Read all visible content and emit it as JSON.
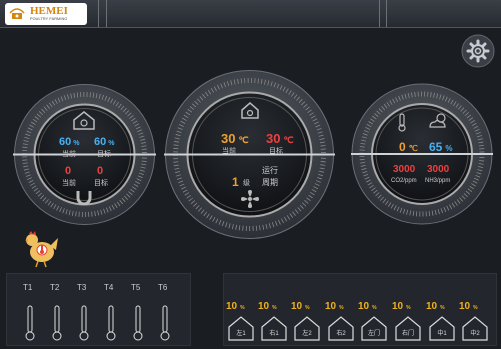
{
  "brand": {
    "name": "HEMEI",
    "tagline": "POULTRY FARMING"
  },
  "colors": {
    "blue": "#4ab0f0",
    "red": "#ee4040",
    "orange": "#f0a030",
    "yellow": "#f0b020"
  },
  "left_dial": {
    "humidity_current": "60",
    "humidity_target": "60",
    "humidity_unit": "%",
    "pressure_current": "0",
    "pressure_target": "0",
    "current_label": "当前",
    "target_label": "目标",
    "top_icon": "house-icon",
    "bottom_icon": "magnet-icon"
  },
  "center_dial": {
    "temp_current": "30",
    "temp_target": "30",
    "temp_unit": "℃",
    "current_label": "当前",
    "target_label": "目标",
    "level_value": "1",
    "level_unit": "级",
    "run_label": "运行",
    "cycle_label": "周期",
    "top_icon": "house-icon",
    "bottom_icon": "fan-icon"
  },
  "right_dial": {
    "outdoor_temp": "0",
    "outdoor_temp_unit": "℃",
    "outdoor_humidity": "65",
    "outdoor_humidity_unit": "%",
    "co2": "3000",
    "co2_label": "CO2/ppm",
    "nh3": "3000",
    "nh3_label": "NH3/ppm",
    "icons": [
      "thermometer-icon",
      "weather-icon"
    ]
  },
  "sensors": {
    "labels": [
      "T1",
      "T2",
      "T3",
      "T4",
      "T5",
      "T6"
    ]
  },
  "vents": {
    "items": [
      {
        "value": "10",
        "unit": "%",
        "label": "左1"
      },
      {
        "value": "10",
        "unit": "%",
        "label": "右1"
      },
      {
        "value": "10",
        "unit": "%",
        "label": "左2"
      },
      {
        "value": "10",
        "unit": "%",
        "label": "右2"
      },
      {
        "value": "10",
        "unit": "%",
        "label": "左门"
      },
      {
        "value": "10",
        "unit": "%",
        "label": "右门"
      },
      {
        "value": "10",
        "unit": "%",
        "label": "中1"
      },
      {
        "value": "10",
        "unit": "%",
        "label": "中2"
      }
    ]
  }
}
